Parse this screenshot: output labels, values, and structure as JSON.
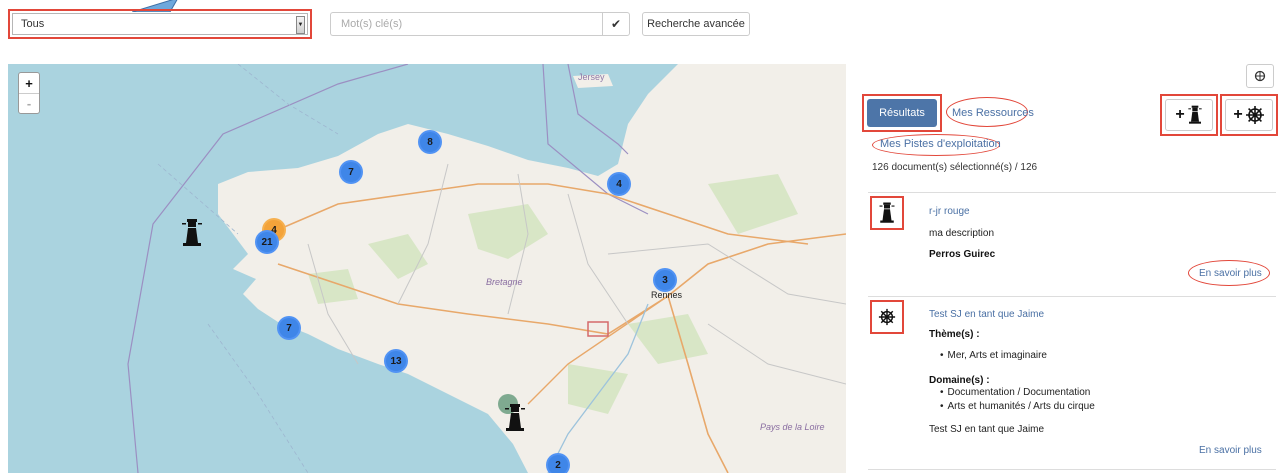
{
  "search": {
    "scope_value": "Tous",
    "keywords_placeholder": "Mot(s) clé(s)",
    "submit_icon": "check-icon",
    "advanced_label": "Recherche avancée"
  },
  "map": {
    "zoom_in_label": "+",
    "zoom_out_label": "-",
    "labels": {
      "jersey": "Jersey",
      "bretagne": "Bretagne",
      "rennes": "Rennes",
      "pays_de_la_loire": "Pays de la Loire"
    },
    "clusters": [
      {
        "count": "8"
      },
      {
        "count": "7"
      },
      {
        "count": "4"
      },
      {
        "count": "4"
      },
      {
        "count": "21"
      },
      {
        "count": "3"
      },
      {
        "count": "7"
      },
      {
        "count": "13"
      },
      {
        "count": "2"
      }
    ],
    "colors": {
      "sea": "#aad3df",
      "land": "#f2efe9",
      "cluster_blue": "#3f86e8",
      "cluster_orange": "#f3a33a"
    }
  },
  "panel": {
    "locate_icon": "crosshair-icon",
    "tabs": {
      "results": "Résultats",
      "resources": "Mes Ressources",
      "pistes": "Mes Pistes d'exploitation"
    },
    "add_buttons": {
      "plus": "+",
      "lighthouse": "lighthouse-icon",
      "helm": "ship-wheel-icon"
    },
    "count_text": "126 document(s) sélectionné(s) / 126",
    "results": [
      {
        "icon": "lighthouse-icon",
        "title": "r-jr rouge",
        "description": "ma description",
        "place": "Perros Guirec",
        "more": "En savoir plus"
      },
      {
        "icon": "ship-wheel-icon",
        "title": "Test SJ en tant que Jaime",
        "theme_label": "Thème(s) :",
        "themes": [
          "Mer, Arts et imaginaire"
        ],
        "domain_label": "Domaine(s) :",
        "domains": [
          "Documentation / Documentation",
          "Arts et humanités / Arts du cirque"
        ],
        "description": "Test SJ en tant que Jaime",
        "more": "En savoir plus"
      }
    ],
    "colors": {
      "accent": "#4d75a8",
      "link": "#4a70a4",
      "highlight": "#e2473a"
    }
  }
}
